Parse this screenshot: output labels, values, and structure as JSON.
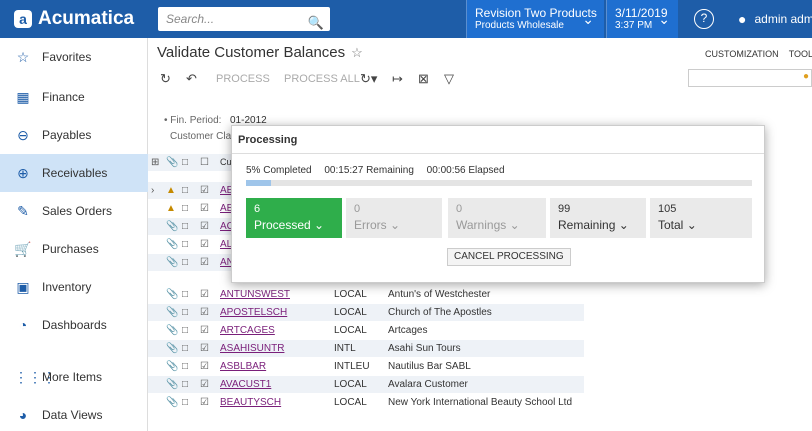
{
  "app": {
    "logo": "Acumatica"
  },
  "header": {
    "search_placeholder": "Search...",
    "tenant_name": "Revision Two Products",
    "tenant_sub": "Products Wholesale",
    "date": "3/11/2019",
    "time": "3:37 PM",
    "user": "admin admi"
  },
  "sidebar": {
    "items": [
      {
        "label": "Favorites",
        "icon": "star-icon"
      },
      {
        "label": "Finance",
        "icon": "calculator-icon"
      },
      {
        "label": "Payables",
        "icon": "minus-circle-icon"
      },
      {
        "label": "Receivables",
        "icon": "plus-circle-icon"
      },
      {
        "label": "Sales Orders",
        "icon": "pencil-icon"
      },
      {
        "label": "Purchases",
        "icon": "cart-icon"
      },
      {
        "label": "Inventory",
        "icon": "truck-icon"
      },
      {
        "label": "Dashboards",
        "icon": "gauge-icon"
      },
      {
        "label": "More Items",
        "icon": "grid-dots-icon"
      },
      {
        "label": "Data Views",
        "icon": "pie-chart-icon"
      }
    ]
  },
  "page": {
    "title": "Validate Customer Balances",
    "customization": "CUSTOMIZATION",
    "tools": "TOOL",
    "toolbar": {
      "process": "PROCESS",
      "process_all": "PROCESS ALL"
    },
    "form": {
      "fin_period_label": "• Fin. Period:",
      "fin_period_value": "01-2012",
      "customer_class_label": "Customer Class"
    }
  },
  "grid": {
    "header_cell": "Cu",
    "rows": [
      {
        "id": "AE",
        "cls": "",
        "name": ""
      },
      {
        "id": "AE",
        "cls": "",
        "name": ""
      },
      {
        "id": "AC",
        "cls": "",
        "name": ""
      },
      {
        "id": "AL",
        "cls": "",
        "name": ""
      },
      {
        "id": "AN",
        "cls": "",
        "name": ""
      },
      {
        "id": "ANTUNSWEST",
        "cls": "LOCAL",
        "name": "Antun's of Westchester"
      },
      {
        "id": "APOSTELSCH",
        "cls": "LOCAL",
        "name": "Church of The Apostles"
      },
      {
        "id": "ARTCAGES",
        "cls": "LOCAL",
        "name": "Artcages"
      },
      {
        "id": "ASAHISUNTR",
        "cls": "INTL",
        "name": "Asahi Sun Tours"
      },
      {
        "id": "ASBLBAR",
        "cls": "INTLEU",
        "name": "Nautilus Bar SABL"
      },
      {
        "id": "AVACUST1",
        "cls": "LOCAL",
        "name": "Avalara Customer"
      },
      {
        "id": "BEAUTYSCH",
        "cls": "LOCAL",
        "name": "New York International Beauty School Ltd"
      }
    ]
  },
  "dialog": {
    "title": "Processing",
    "completed": "5% Completed",
    "remaining_time": "00:15:27 Remaining",
    "elapsed": "00:00:56 Elapsed",
    "progress": 0.05,
    "cards": [
      {
        "count": "6",
        "label": "Processed"
      },
      {
        "count": "0",
        "label": "Errors"
      },
      {
        "count": "0",
        "label": "Warnings"
      },
      {
        "count": "99",
        "label": "Remaining"
      },
      {
        "count": "105",
        "label": "Total"
      }
    ],
    "cancel_label": "CANCEL PROCESSING"
  },
  "colors": {
    "brand": "#1e5da8",
    "success": "#2fae4b",
    "link": "#7a1f7a",
    "active_nav": "#cfe3f7"
  }
}
